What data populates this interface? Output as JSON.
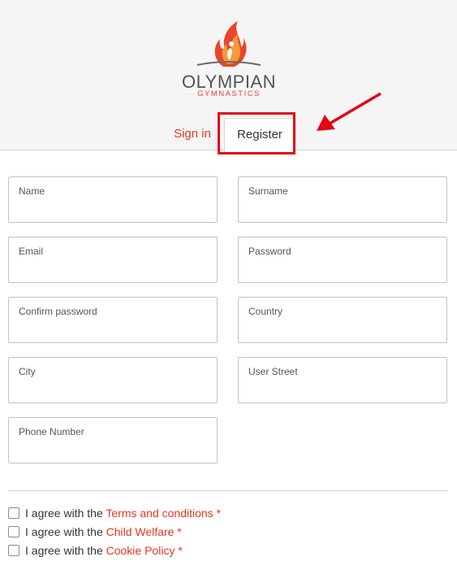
{
  "brand": {
    "name": "OLYMPIAN",
    "subtitle": "GYMNASTICS"
  },
  "tabs": {
    "signin": "Sign in",
    "register": "Register"
  },
  "form": {
    "fields": [
      {
        "label": "Name",
        "value": ""
      },
      {
        "label": "Surname",
        "value": ""
      },
      {
        "label": "Email",
        "value": ""
      },
      {
        "label": "Password",
        "value": ""
      },
      {
        "label": "Confirm password",
        "value": ""
      },
      {
        "label": "Country",
        "value": ""
      },
      {
        "label": "City",
        "value": ""
      },
      {
        "label": "User Street",
        "value": ""
      },
      {
        "label": "Phone Number",
        "value": ""
      }
    ]
  },
  "agreements": [
    {
      "prefix": "I agree with the ",
      "link": "Terms and conditions",
      "required": " *",
      "checked": false
    },
    {
      "prefix": "I agree with the ",
      "link": "Child Welfare",
      "required": " *",
      "checked": false
    },
    {
      "prefix": "I agree with the ",
      "link": "Cookie Policy",
      "required": " *",
      "checked": false
    }
  ],
  "colors": {
    "accent": "#e8351e",
    "highlight": "#e30613",
    "header_bg": "#f5f5f5"
  }
}
